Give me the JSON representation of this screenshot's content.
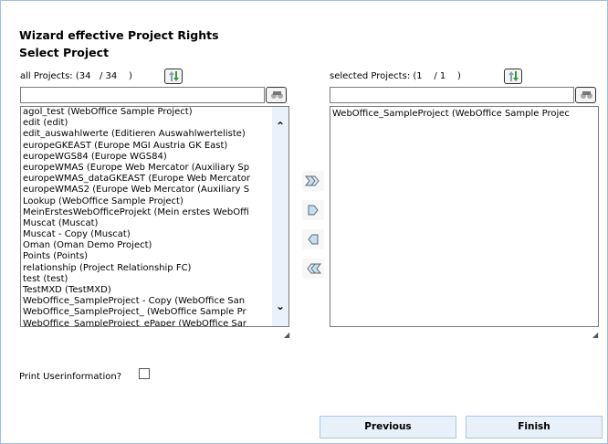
{
  "header": {
    "title": "Wizard effective Project Rights",
    "subtitle": "Select Project"
  },
  "all_projects": {
    "label": "all Projects: (34   / 34    )",
    "filter_value": "",
    "items": [
      "agol_test (WebOffice Sample Project)",
      "edit (edit)",
      "edit_auswahlwerte (Editieren Auswahlwerteliste)",
      "europeGKEAST (Europe MGI Austria GK East)",
      "europeWGS84 (Europe WGS84)",
      "europeWMAS (Europe Web Mercator (Auxiliary Sp",
      "europeWMAS_dataGKEAST (Europe Web Mercator",
      "europeWMAS2 (Europe Web Mercator (Auxiliary S",
      "Lookup (WebOffice Sample Project)",
      "MeinErstesWebOfficeProjekt (Mein erstes WebOffi",
      "Muscat (Muscat)",
      "Muscat - Copy (Muscat)",
      "Oman (Oman Demo Project)",
      "Points (Points)",
      "relationship (Project Relationship FC)",
      "test (test)",
      "TestMXD (TestMXD)",
      "WebOffice_SampleProject - Copy (WebOffice San",
      "WebOffice_SampleProject_ (WebOffice Sample Pr",
      "WebOffice_SampleProject_ePaper (WebOffice Sar"
    ]
  },
  "selected_projects": {
    "label": "selected Projects: (1    / 1    )",
    "filter_value": "",
    "items": [
      "WebOffice_SampleProject (WebOffice Sample Projec"
    ]
  },
  "options": {
    "print_userinfo_label": "Print Userinformation?",
    "print_userinfo_checked": false
  },
  "footer": {
    "previous": "Previous",
    "finish": "Finish"
  }
}
